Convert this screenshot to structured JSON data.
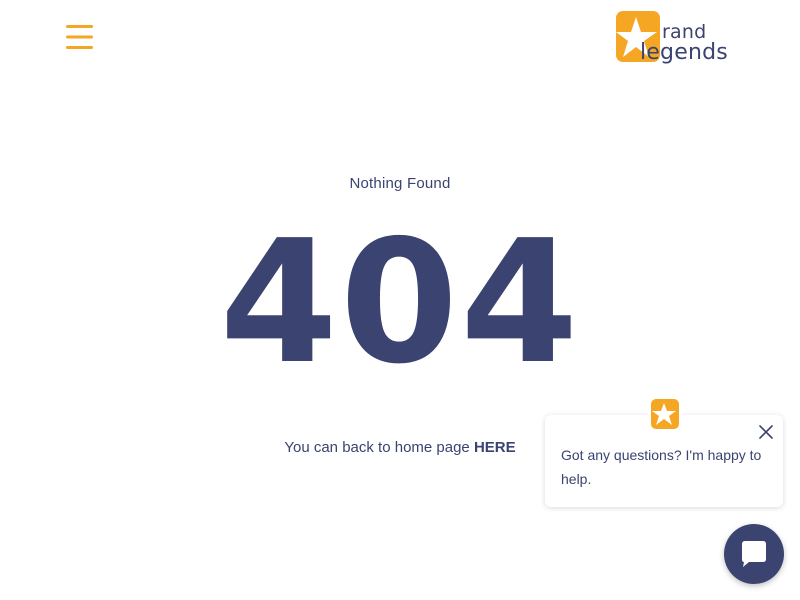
{
  "header": {
    "menu_icon": "hamburger-icon",
    "logo": {
      "icon": "star-icon",
      "line1": "rand",
      "line2": "legends",
      "alt": "Brand Legends"
    }
  },
  "main": {
    "subtitle": "Nothing Found",
    "code": "404",
    "back_text": "You can back to home page",
    "back_link": "HERE"
  },
  "chat": {
    "avatar_icon": "star-icon",
    "close_icon": "close-icon",
    "message": "Got any questions? I'm happy to help.",
    "launcher_icon": "chat-bubble-icon"
  },
  "colors": {
    "accent": "#f5a623",
    "primary": "#3b4370",
    "background": "#ffffff"
  }
}
